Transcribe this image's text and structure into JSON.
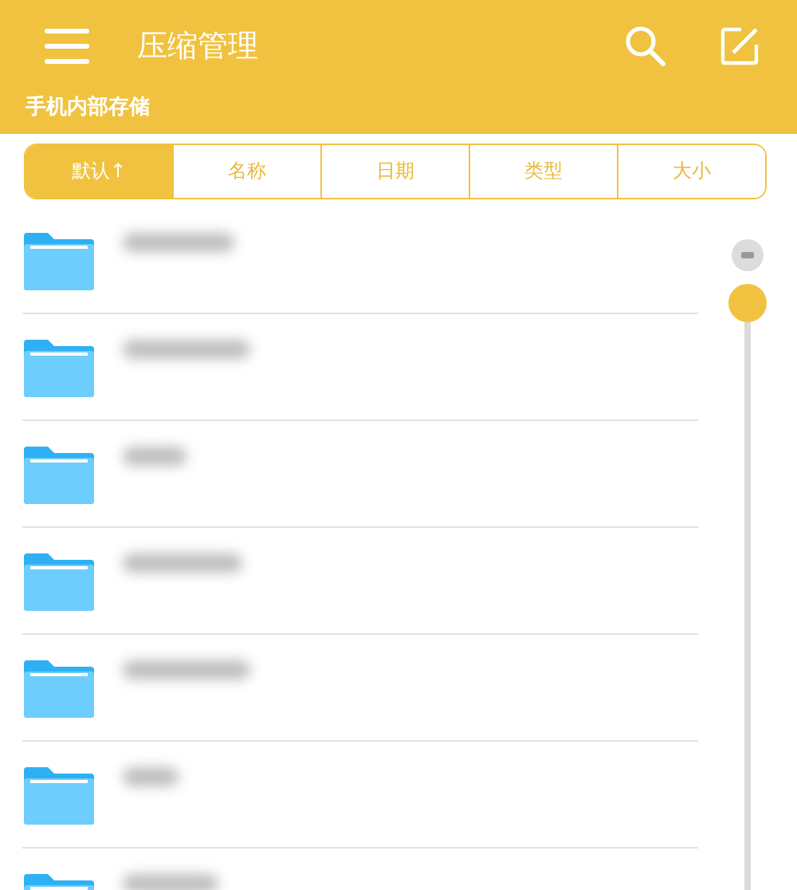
{
  "header": {
    "title": "压缩管理",
    "location": "手机内部存储"
  },
  "sort_tabs": [
    {
      "label": "默认↑",
      "selected": true
    },
    {
      "label": "名称",
      "selected": false
    },
    {
      "label": "日期",
      "selected": false
    },
    {
      "label": "类型",
      "selected": false
    },
    {
      "label": "大小",
      "selected": false
    }
  ],
  "items": [
    {
      "kind": "folder"
    },
    {
      "kind": "folder"
    },
    {
      "kind": "folder"
    },
    {
      "kind": "folder"
    },
    {
      "kind": "folder"
    },
    {
      "kind": "folder"
    },
    {
      "kind": "folder"
    }
  ]
}
